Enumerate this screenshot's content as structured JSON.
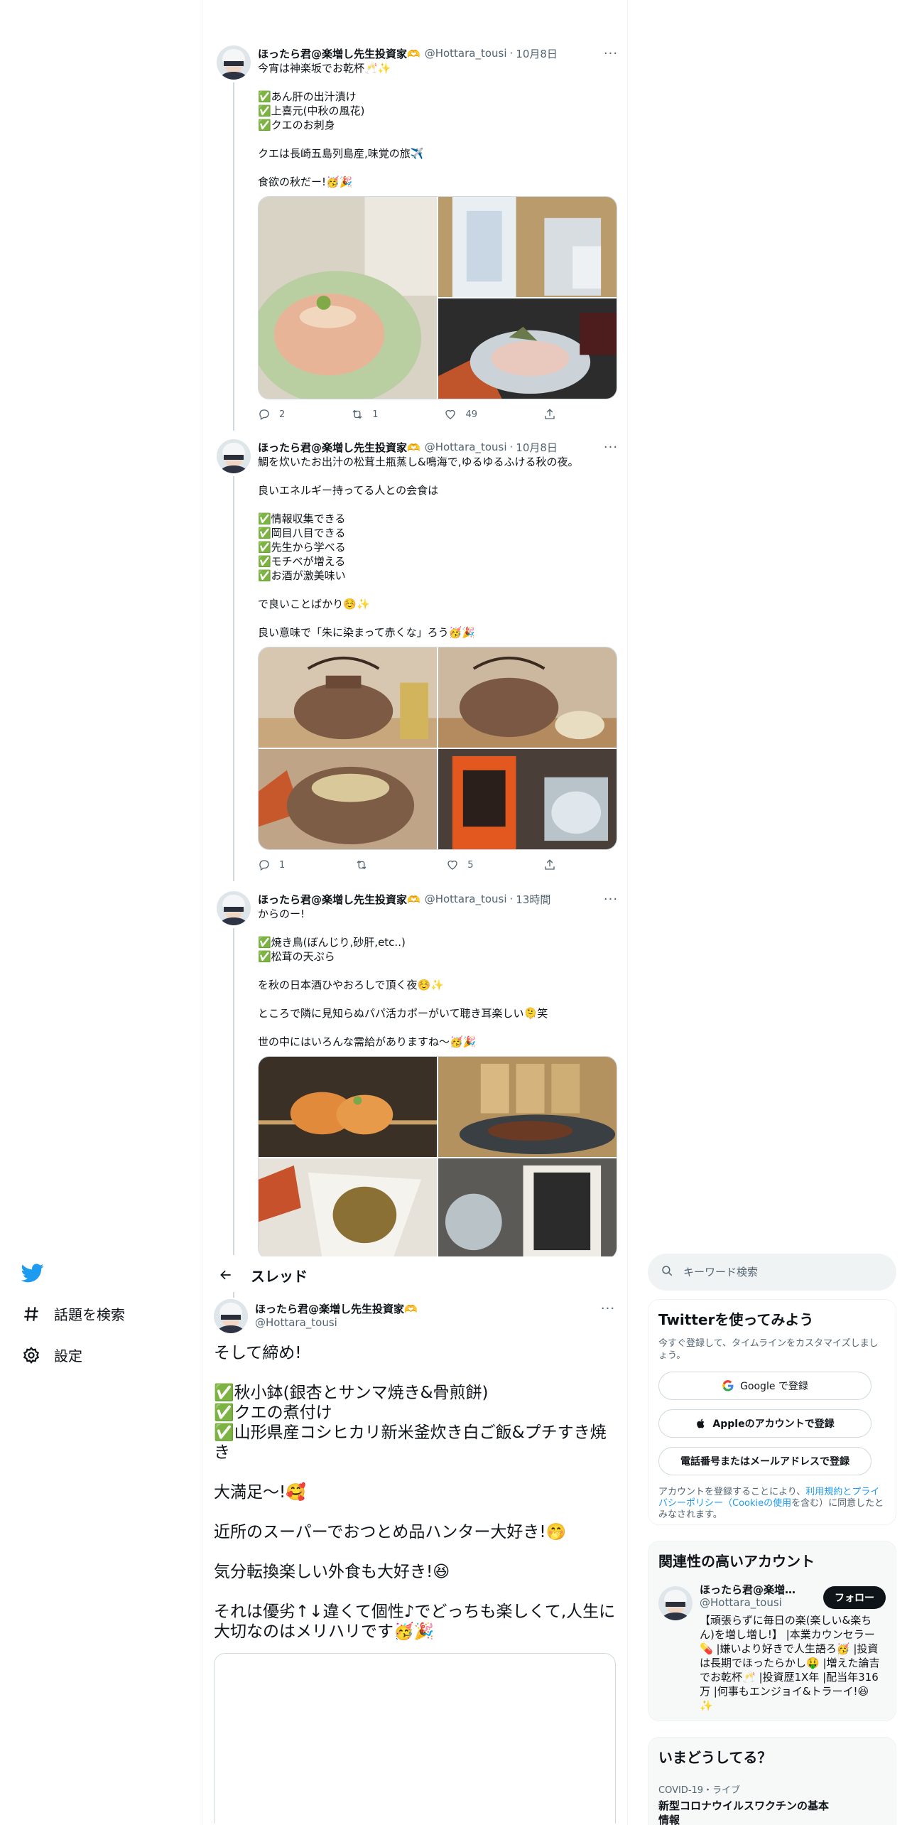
{
  "nav": {
    "logo_icon": "twitter-bird-icon",
    "explore_label": "話題を検索",
    "settings_label": "設定"
  },
  "thread": {
    "header_title": "スレッド",
    "tweets": [
      {
        "name": "ほったら君@楽増し先生投資家🫶",
        "handle": "@Hottara_tousi",
        "dot": "·",
        "time": "10月8日",
        "text": "今宵は神楽坂でお乾杯🥂✨\n\n✅あん肝の出汁漬け\n✅上喜元(中秋の風花)\n✅クエのお刺身\n\nクエは長崎五島列島産,味覚の旅✈️\n\n食欲の秋だー!🥳🎉",
        "reply_count": "2",
        "retweet_count": "1",
        "like_count": "49"
      },
      {
        "name": "ほったら君@楽増し先生投資家🫶",
        "handle": "@Hottara_tousi",
        "dot": "·",
        "time": "10月8日",
        "text": "鯛を炊いたお出汁の松茸土瓶蒸し&鳴海で,ゆるゆるふける秋の夜。\n\n良いエネルギー持ってる人との会食は\n\n✅情報収集できる\n✅岡目八目できる\n✅先生から学べる\n✅モチベが増える\n✅お酒が激美味い\n\nで良いことばかり☺️✨\n\n良い意味で「朱に染まって赤くな」ろう🥳🎉",
        "reply_count": "1",
        "retweet_count": "",
        "like_count": "5"
      },
      {
        "name": "ほったら君@楽増し先生投資家🫶",
        "handle": "@Hottara_tousi",
        "dot": "·",
        "time": "13時間",
        "text": "からのー!\n\n✅焼き鳥(ぼんじり,砂肝,etc..)\n✅松茸の天ぷら\n\nを秋の日本酒ひやおろしで頂く夜☺️✨\n\nところで隣に見知らぬパパ活カポーがいて聴き耳楽しい🫠笑\n\n世の中にはいろんな需給がありますね〜🥳🎉"
      }
    ],
    "focus": {
      "name": "ほったら君@楽増し先生投資家🫶",
      "handle": "@Hottara_tousi",
      "text": "そして締め!\n\n✅秋小鉢(銀杏とサンマ焼き&骨煎餅)\n✅クエの煮付け\n✅山形県産コシヒカリ新米釜炊き白ご飯&プチすき焼き\n\n大満足〜!🥰\n\n近所のスーパーでおつとめ品ハンター大好き!🤭\n\n気分転換楽しい外食も大好き!😆\n\nそれは優劣↑↓違くて個性♪でどっちも楽しくて,人生に大切なのはメリハリです🥳🎉"
    }
  },
  "search": {
    "placeholder": "キーワード検索"
  },
  "signup_card": {
    "title": "Twitterを使ってみよう",
    "subtitle": "今すぐ登録して、タイムラインをカスタマイズしましょう。",
    "google_label": "Google で登録",
    "apple_label": "Appleのアカウントで登録",
    "phone_label": "電話番号またはメールアドレスで登録",
    "legal_prefix": "アカウントを登録することにより、",
    "legal_link1": "利用規約とプライバシーポリシー（Cookieの使用",
    "legal_suffix": "を含む）に同意したとみなされます。"
  },
  "relevant": {
    "title": "関連性の高いアカウント",
    "name": "ほったら君@楽増し...",
    "handle": "@Hottara_tousi",
    "follow_label": "フォロー",
    "bio": "【頑張らずに毎日の楽(楽しい&楽ちん)を増し増し!】 |本業カウンセラー💊 |嫌いより好きで人生語ろ🥳 |投資は長期でほったらかし🤑 |増えた論吉でお乾杯🥂 |投資歴1X年 |配当年316万 |何事もエンジョイ&トラーイ!😆✨"
  },
  "trends": {
    "title": "いまどうしてる？",
    "meta": "COVID-19・ライブ",
    "headline": "新型コロナウイルスワクチンの基本情報"
  },
  "colors": {
    "accent": "#1d9bf0",
    "text": "#0f1419",
    "secondary": "#536471",
    "border": "#cfd9de"
  }
}
